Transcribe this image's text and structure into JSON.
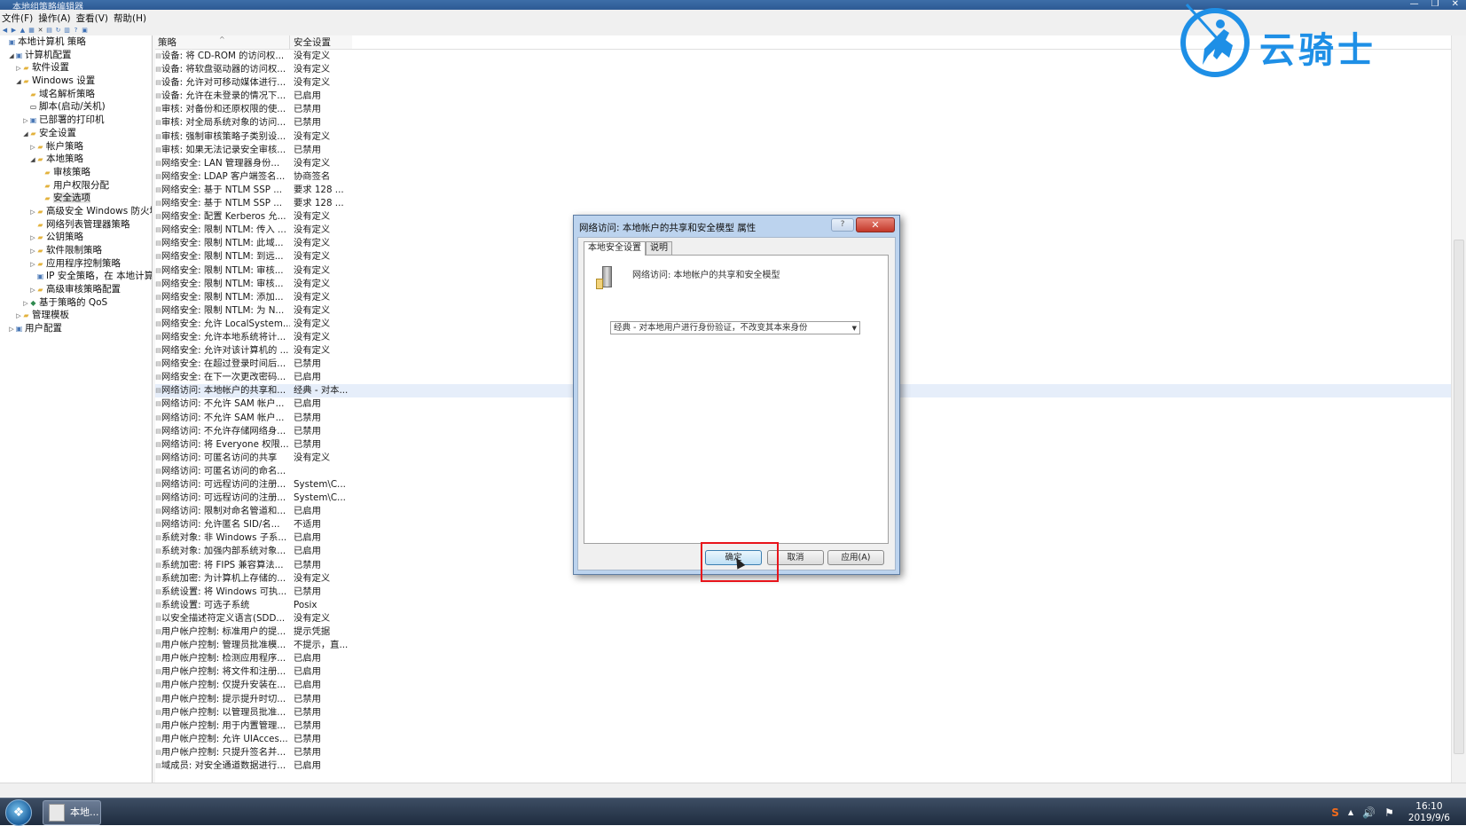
{
  "window": {
    "title": "本地组策略编辑器",
    "controls": [
      "—",
      "❐",
      "✕"
    ]
  },
  "menu": [
    "文件(F)",
    "操作(A)",
    "查看(V)",
    "帮助(H)"
  ],
  "toolbar_icons": [
    "back-icon",
    "forward-icon",
    "up-icon",
    "show-hide-tree-icon",
    "delete-icon",
    "properties-icon",
    "refresh-icon",
    "export-icon",
    "help-icon",
    "view-icon"
  ],
  "tree": [
    {
      "label": "本地计算机 策略",
      "level": 0,
      "exp": "",
      "icon": "comp"
    },
    {
      "label": "计算机配置",
      "level": 1,
      "exp": "◢",
      "icon": "comp"
    },
    {
      "label": "软件设置",
      "level": 2,
      "exp": "▷",
      "icon": "folder"
    },
    {
      "label": "Windows 设置",
      "level": 2,
      "exp": "◢",
      "icon": "folder"
    },
    {
      "label": "域名解析策略",
      "level": 3,
      "exp": "",
      "icon": "folder"
    },
    {
      "label": "脚本(启动/关机)",
      "level": 3,
      "exp": "",
      "icon": "doc"
    },
    {
      "label": "已部署的打印机",
      "level": 3,
      "exp": "▷",
      "icon": "comp"
    },
    {
      "label": "安全设置",
      "level": 3,
      "exp": "◢",
      "icon": "folder"
    },
    {
      "label": "帐户策略",
      "level": 4,
      "exp": "▷",
      "icon": "folder"
    },
    {
      "label": "本地策略",
      "level": 4,
      "exp": "◢",
      "icon": "folder"
    },
    {
      "label": "审核策略",
      "level": 5,
      "exp": "",
      "icon": "folder"
    },
    {
      "label": "用户权限分配",
      "level": 5,
      "exp": "",
      "icon": "folder"
    },
    {
      "label": "安全选项",
      "level": 5,
      "exp": "",
      "icon": "folder",
      "selected": true
    },
    {
      "label": "高级安全 Windows 防火墙",
      "level": 4,
      "exp": "▷",
      "icon": "folder"
    },
    {
      "label": "网络列表管理器策略",
      "level": 4,
      "exp": "",
      "icon": "folder"
    },
    {
      "label": "公钥策略",
      "level": 4,
      "exp": "▷",
      "icon": "folder"
    },
    {
      "label": "软件限制策略",
      "level": 4,
      "exp": "▷",
      "icon": "folder"
    },
    {
      "label": "应用程序控制策略",
      "level": 4,
      "exp": "▷",
      "icon": "folder"
    },
    {
      "label": "IP 安全策略，在 本地计算机",
      "level": 4,
      "exp": "",
      "icon": "comp"
    },
    {
      "label": "高级审核策略配置",
      "level": 4,
      "exp": "▷",
      "icon": "folder"
    },
    {
      "label": "基于策略的 QoS",
      "level": 3,
      "exp": "▷",
      "icon": "net"
    },
    {
      "label": "管理模板",
      "level": 2,
      "exp": "▷",
      "icon": "folder"
    },
    {
      "label": "用户配置",
      "level": 1,
      "exp": "▷",
      "icon": "comp"
    }
  ],
  "columns": {
    "policy": "策略",
    "setting": "安全设置"
  },
  "rows": [
    [
      "设备: 将 CD-ROM 的访问权...",
      "没有定义"
    ],
    [
      "设备: 将软盘驱动器的访问权...",
      "没有定义"
    ],
    [
      "设备: 允许对可移动媒体进行...",
      "没有定义"
    ],
    [
      "设备: 允许在未登录的情况下...",
      "已启用"
    ],
    [
      "审核: 对备份和还原权限的使...",
      "已禁用"
    ],
    [
      "审核: 对全局系统对象的访问...",
      "已禁用"
    ],
    [
      "审核: 强制审核策略子类别设...",
      "没有定义"
    ],
    [
      "审核: 如果无法记录安全审核...",
      "已禁用"
    ],
    [
      "网络安全: LAN 管理器身份...",
      "没有定义"
    ],
    [
      "网络安全: LDAP 客户端签名...",
      "协商签名"
    ],
    [
      "网络安全: 基于 NTLM SSP ...",
      "要求 128 ..."
    ],
    [
      "网络安全: 基于 NTLM SSP ...",
      "要求 128 ..."
    ],
    [
      "网络安全: 配置 Kerberos 允...",
      "没有定义"
    ],
    [
      "网络安全: 限制 NTLM: 传入 ...",
      "没有定义"
    ],
    [
      "网络安全: 限制 NTLM: 此域...",
      "没有定义"
    ],
    [
      "网络安全: 限制 NTLM: 到远...",
      "没有定义"
    ],
    [
      "网络安全: 限制 NTLM: 审核...",
      "没有定义"
    ],
    [
      "网络安全: 限制 NTLM: 审核...",
      "没有定义"
    ],
    [
      "网络安全: 限制 NTLM: 添加...",
      "没有定义"
    ],
    [
      "网络安全: 限制 NTLM: 为 N...",
      "没有定义"
    ],
    [
      "网络安全: 允许 LocalSystem...",
      "没有定义"
    ],
    [
      "网络安全: 允许本地系统将计...",
      "没有定义"
    ],
    [
      "网络安全: 允许对该计算机的 ...",
      "没有定义"
    ],
    [
      "网络安全: 在超过登录时间后...",
      "已禁用"
    ],
    [
      "网络安全: 在下一次更改密码...",
      "已启用"
    ],
    [
      "网络访问: 本地帐户的共享和...",
      "经典 - 对本..."
    ],
    [
      "网络访问: 不允许 SAM 帐户...",
      "已启用"
    ],
    [
      "网络访问: 不允许 SAM 帐户...",
      "已禁用"
    ],
    [
      "网络访问: 不允许存储网络身...",
      "已禁用"
    ],
    [
      "网络访问: 将 Everyone 权限...",
      "已禁用"
    ],
    [
      "网络访问: 可匿名访问的共享",
      "没有定义"
    ],
    [
      "网络访问: 可匿名访问的命名...",
      ""
    ],
    [
      "网络访问: 可远程访问的注册...",
      "System\\C..."
    ],
    [
      "网络访问: 可远程访问的注册...",
      "System\\C..."
    ],
    [
      "网络访问: 限制对命名管道和...",
      "已启用"
    ],
    [
      "网络访问: 允许匿名 SID/名...",
      "不适用"
    ],
    [
      "系统对象: 非 Windows 子系...",
      "已启用"
    ],
    [
      "系统对象: 加强内部系统对象...",
      "已启用"
    ],
    [
      "系统加密: 将 FIPS 兼容算法...",
      "已禁用"
    ],
    [
      "系统加密: 为计算机上存储的...",
      "没有定义"
    ],
    [
      "系统设置: 将 Windows 可执...",
      "已禁用"
    ],
    [
      "系统设置: 可选子系统",
      "Posix"
    ],
    [
      "以安全描述符定义语言(SDD...",
      "没有定义"
    ],
    [
      "用户帐户控制: 标准用户的提...",
      "提示凭据"
    ],
    [
      "用户帐户控制: 管理员批准模...",
      "不提示，直..."
    ],
    [
      "用户帐户控制: 检测应用程序...",
      "已启用"
    ],
    [
      "用户帐户控制: 将文件和注册...",
      "已启用"
    ],
    [
      "用户帐户控制: 仅提升安装在...",
      "已启用"
    ],
    [
      "用户帐户控制: 提示提升时切...",
      "已禁用"
    ],
    [
      "用户帐户控制: 以管理员批准...",
      "已禁用"
    ],
    [
      "用户帐户控制: 用于内置管理...",
      "已禁用"
    ],
    [
      "用户帐户控制: 允许 UIAcces...",
      "已禁用"
    ],
    [
      "用户帐户控制: 只提升签名并...",
      "已禁用"
    ],
    [
      "域成员: 对安全通道数据进行...",
      "已启用"
    ]
  ],
  "selected_row_index": 25,
  "dialog": {
    "title": "网络访问: 本地帐户的共享和安全模型 属性",
    "help": "?",
    "close": "✕",
    "tabs": [
      "本地安全设置",
      "说明"
    ],
    "policy_name": "网络访问: 本地帐户的共享和安全模型",
    "dropdown_value": "经典 - 对本地用户进行身份验证，不改变其本来身份",
    "dropdown_arrow": "▼",
    "ok": "确定",
    "cancel": "取消",
    "apply": "应用(A)"
  },
  "taskbar": {
    "start_glyph": "❖",
    "app_label": "本地...",
    "tray": {
      "sogou": "S",
      "up": "▲",
      "volume": "🔊",
      "flag": "⚑"
    },
    "time": "16:10",
    "date": "2019/9/6"
  },
  "watermark": {
    "text": "云骑士"
  },
  "colors": {
    "accent": "#1e8fe6",
    "highlight_box": "#e8141b",
    "title_blue": "#2d5a94"
  }
}
